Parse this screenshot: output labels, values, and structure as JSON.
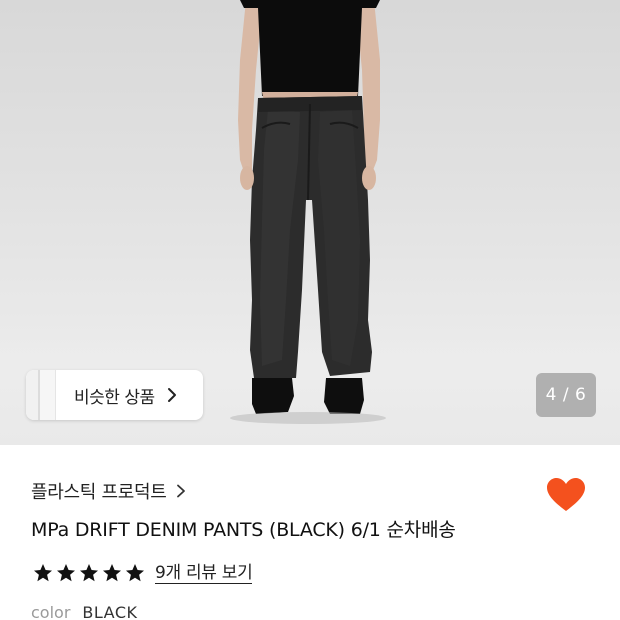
{
  "gallery": {
    "similar_button_label": "비슷한 상품",
    "image_counter": "4 / 6"
  },
  "product": {
    "brand": "플라스틱 프로덕트",
    "title": "MPa DRIFT DENIM PANTS (BLACK) 6/1 순차배송",
    "rating_stars": 5,
    "review_link": "9개 리뷰 보기",
    "option_key": "color",
    "option_value": "BLACK"
  },
  "colors": {
    "like_heart": "#f4511e",
    "stars": "#111111"
  },
  "icons": {
    "like": "heart-icon",
    "chevron": "chevron-right-icon",
    "rating": "star-icon"
  }
}
